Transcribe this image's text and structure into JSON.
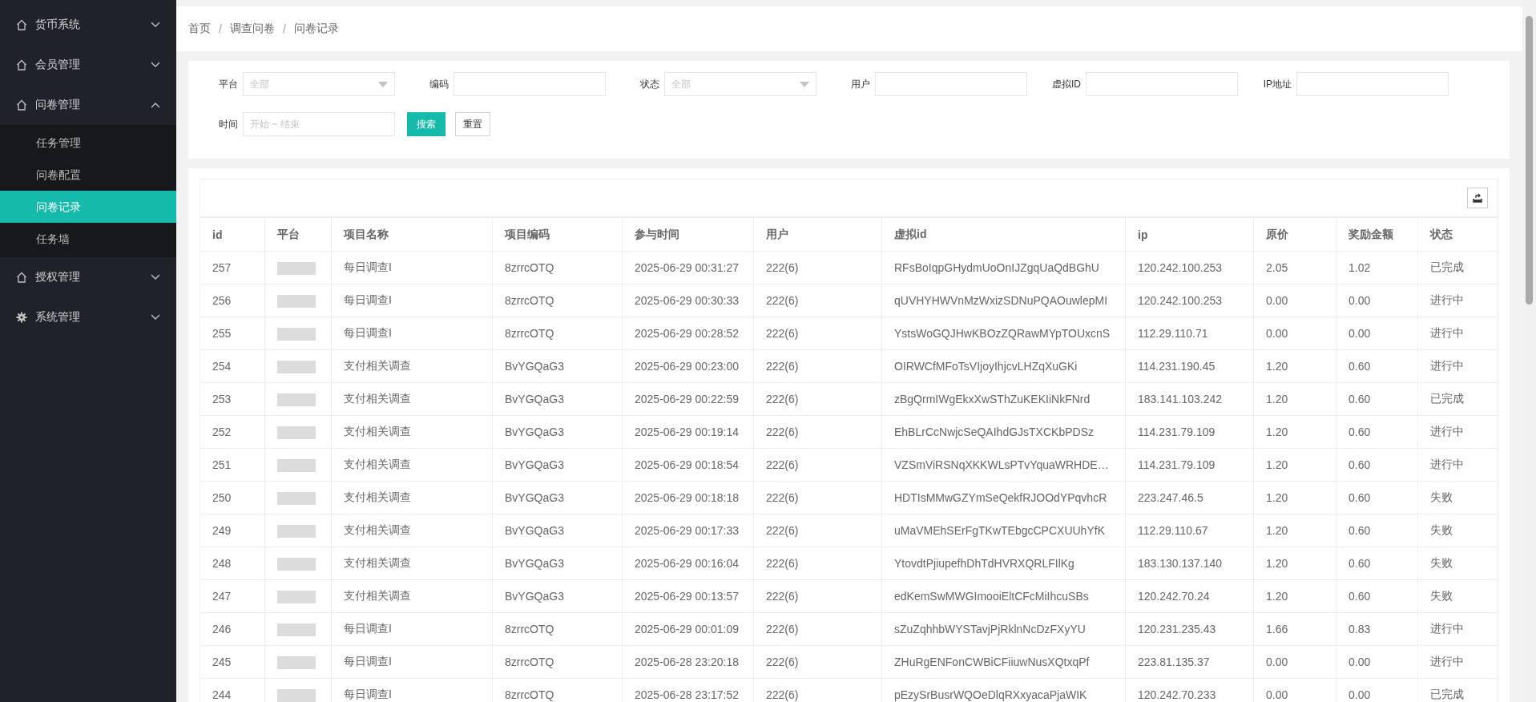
{
  "sidebar": {
    "items": [
      {
        "label": "货币系统",
        "kind": "home",
        "expanded": false
      },
      {
        "label": "会员管理",
        "kind": "home",
        "expanded": false
      },
      {
        "label": "问卷管理",
        "kind": "home",
        "expanded": true,
        "children": [
          {
            "label": "任务管理",
            "selected": false
          },
          {
            "label": "问卷配置",
            "selected": false
          },
          {
            "label": "问卷记录",
            "selected": true
          },
          {
            "label": "任务墙",
            "selected": false
          }
        ]
      },
      {
        "label": "授权管理",
        "kind": "home",
        "expanded": false
      },
      {
        "label": "系统管理",
        "kind": "gear",
        "expanded": false
      }
    ]
  },
  "breadcrumb": {
    "separator": "/",
    "items": [
      "首页",
      "调查问卷",
      "问卷记录"
    ]
  },
  "filters": [
    {
      "label": "平台",
      "kind": "select",
      "placeholder": "全部"
    },
    {
      "label": "编码",
      "kind": "input"
    },
    {
      "label": "状态",
      "kind": "select",
      "placeholder": "全部"
    },
    {
      "label": "用户",
      "kind": "input"
    },
    {
      "label": "虚拟ID",
      "kind": "input"
    },
    {
      "label": "IP地址",
      "kind": "input"
    },
    {
      "label": "时间",
      "kind": "input",
      "placeholder": "开始 ~ 结束"
    }
  ],
  "filter_buttons": [
    {
      "label": "搜索",
      "kind": "primary"
    },
    {
      "label": "重置",
      "kind": "plain"
    }
  ],
  "table": {
    "columns": [
      "id",
      "平台",
      "项目名称",
      "项目编码",
      "参与时间",
      "用户",
      "虚拟id",
      "ip",
      "原价",
      "奖励金额",
      "状态"
    ],
    "rows": [
      [
        "257",
        "",
        "每日调查I",
        "8zrrcOTQ",
        "2025-06-29 00:31:27",
        "222(6)",
        "RFsBoIqpGHydmUoOnIJZgqUaQdBGhU",
        "120.242.100.253",
        "2.05",
        "1.02",
        "已完成"
      ],
      [
        "256",
        "",
        "每日调查I",
        "8zrrcOTQ",
        "2025-06-29 00:30:33",
        "222(6)",
        "qUVHYHWVnMzWxizSDNuPQAOuwlepMI",
        "120.242.100.253",
        "0.00",
        "0.00",
        "进行中"
      ],
      [
        "255",
        "",
        "每日调查I",
        "8zrrcOTQ",
        "2025-06-29 00:28:52",
        "222(6)",
        "YstsWoGQJHwKBOzZQRawMYpTOUxcnS",
        "112.29.110.71",
        "0.00",
        "0.00",
        "进行中"
      ],
      [
        "254",
        "",
        "支付相关调查",
        "BvYGQaG3",
        "2025-06-29 00:23:00",
        "222(6)",
        "OIRWCfMFoTsVIjoyIhjcvLHZqXuGKi",
        "114.231.190.45",
        "1.20",
        "0.60",
        "进行中"
      ],
      [
        "253",
        "",
        "支付相关调查",
        "BvYGQaG3",
        "2025-06-29 00:22:59",
        "222(6)",
        "zBgQrmIWgEkxXwSThZuKEKIiNkFNrd",
        "183.141.103.242",
        "1.20",
        "0.60",
        "已完成"
      ],
      [
        "252",
        "",
        "支付相关调查",
        "BvYGQaG3",
        "2025-06-29 00:19:14",
        "222(6)",
        "EhBLrCcNwjcSeQAIhdGJsTXCKbPDSz",
        "114.231.79.109",
        "1.20",
        "0.60",
        "进行中"
      ],
      [
        "251",
        "",
        "支付相关调查",
        "BvYGQaG3",
        "2025-06-29 00:18:54",
        "222(6)",
        "VZSmViRSNqXKKWLsPTvYquaWRHDE…",
        "114.231.79.109",
        "1.20",
        "0.60",
        "进行中"
      ],
      [
        "250",
        "",
        "支付相关调查",
        "BvYGQaG3",
        "2025-06-29 00:18:18",
        "222(6)",
        "HDTIsMMwGZYmSeQekfRJOOdYPqvhcR",
        "223.247.46.5",
        "1.20",
        "0.60",
        "失败"
      ],
      [
        "249",
        "",
        "支付相关调查",
        "BvYGQaG3",
        "2025-06-29 00:17:33",
        "222(6)",
        "uMaVMEhSErFgTKwTEbgcCPCXUUhYfK",
        "112.29.110.67",
        "1.20",
        "0.60",
        "失败"
      ],
      [
        "248",
        "",
        "支付相关调查",
        "BvYGQaG3",
        "2025-06-29 00:16:04",
        "222(6)",
        "YtovdtPjiupefhDhTdHVRXQRLFIlKg",
        "183.130.137.140",
        "1.20",
        "0.60",
        "失败"
      ],
      [
        "247",
        "",
        "支付相关调查",
        "BvYGQaG3",
        "2025-06-29 00:13:57",
        "222(6)",
        "edKemSwMWGImooiEltCFcMiIhcuSBs",
        "120.242.70.24",
        "1.20",
        "0.60",
        "失败"
      ],
      [
        "246",
        "",
        "每日调查I",
        "8zrrcOTQ",
        "2025-06-29 00:01:09",
        "222(6)",
        "sZuZqhhbWYSTavjPjRklnNcDzFXyYU",
        "120.231.235.43",
        "1.66",
        "0.83",
        "进行中"
      ],
      [
        "245",
        "",
        "每日调查I",
        "8zrrcOTQ",
        "2025-06-28 23:20:18",
        "222(6)",
        "ZHuRgENFonCWBiCFiiuwNusXQtxqPf",
        "223.81.135.37",
        "0.00",
        "0.00",
        "进行中"
      ],
      [
        "244",
        "",
        "每日调查I",
        "8zrrcOTQ",
        "2025-06-28 23:17:52",
        "222(6)",
        "pEzySrBusrWQOeDlqRXxyacaPjaWIK",
        "120.242.70.233",
        "0.00",
        "0.00",
        "已完成"
      ]
    ]
  }
}
